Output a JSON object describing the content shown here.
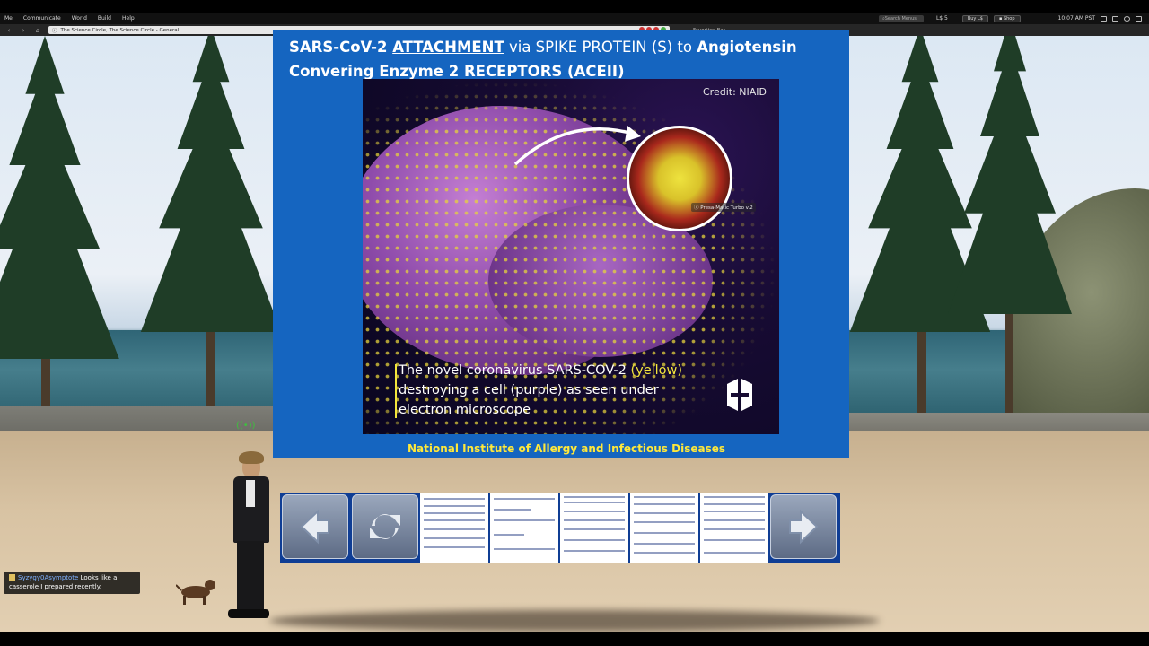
{
  "menubar": {
    "items": [
      "Me",
      "Communicate",
      "World",
      "Build",
      "Help"
    ],
    "search_placeholder": "Search Menus",
    "balance": "L$ 5",
    "buy_label": "Buy L$",
    "shop_label": "Shop",
    "time": "10:07 AM PST"
  },
  "navbar": {
    "location": "The Science Circle, The Science Circle - General",
    "favorites_label": "Favorites Bar"
  },
  "board": {
    "title_part1": "SARS-CoV-2 ",
    "title_underlined": "ATTACHMENT",
    "title_part2": " via SPIKE PROTEIN (S) to ",
    "title_part3": "Angiotensin",
    "title_line2": "Convering Enzyme 2 RECEPTORS (ACEII)",
    "credit": "Credit: NIAID",
    "caption_part1": "The novel coronavirus SARS-COV-2 ",
    "caption_yellow": "(yellow)",
    "caption_line2": "destroying a cell (purple) as seen under",
    "caption_line3": "electron microscope",
    "footer": "National Institute of Allergy and Infectious Diseases",
    "object_label": "Presa-Matic Turbo v.2"
  },
  "controls": {
    "prev_icon": "left-arrow-icon",
    "reload_icon": "refresh-icon",
    "next_icon": "right-arrow-icon"
  },
  "chat": {
    "name": "Syzygy0Asymptote",
    "message_part1": " Looks like a",
    "message_part2": "casserole I prepared recently."
  },
  "colors": {
    "board_blue": "#1565c0",
    "title_white": "#ffffff",
    "footer_yellow": "#ffe83a",
    "caption_yellow": "#f2e53c"
  }
}
